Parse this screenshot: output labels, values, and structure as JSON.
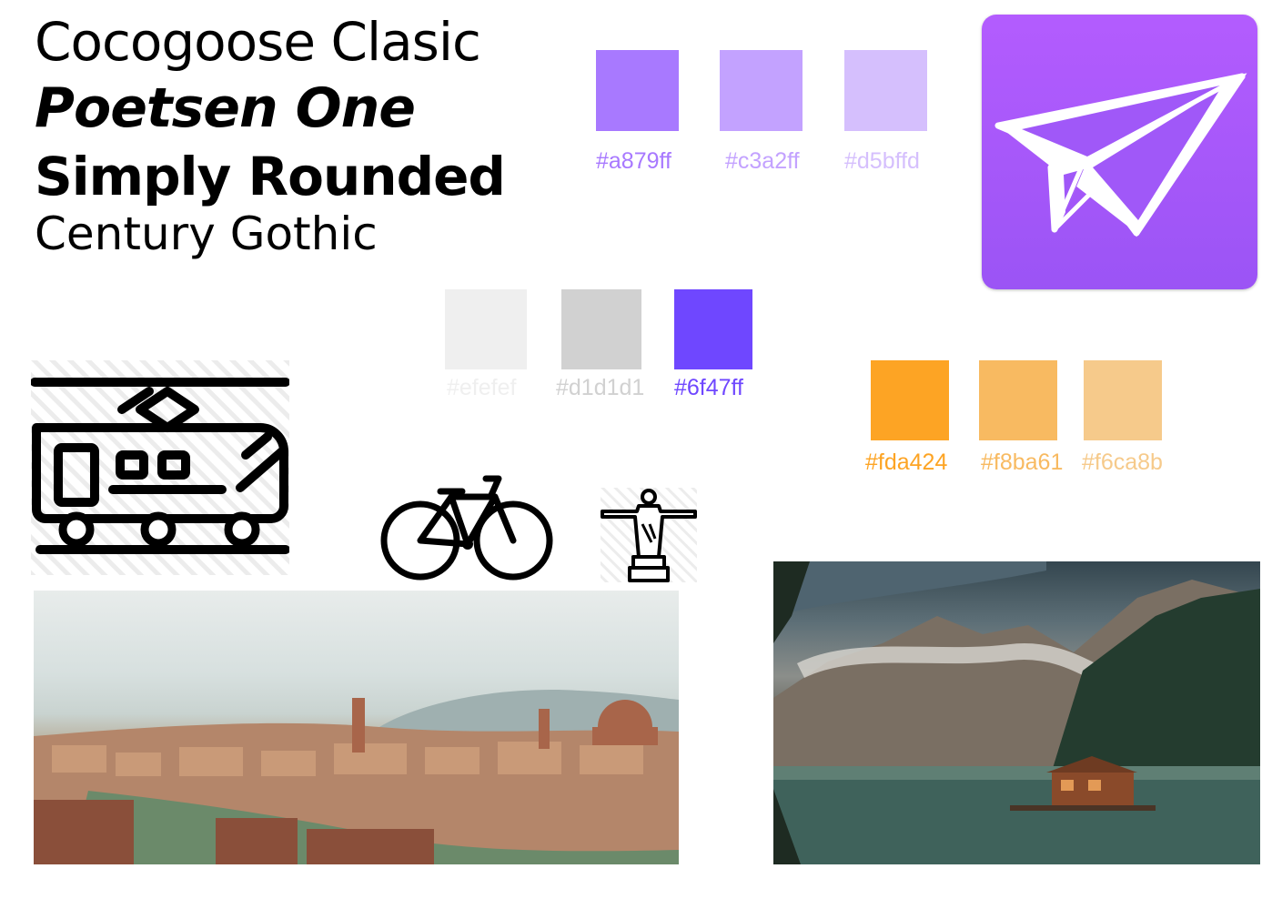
{
  "fonts": [
    "Cocogoose Clasic",
    "Poetsen One",
    "Simply Rounded",
    "Century Gothic"
  ],
  "palettes": {
    "purple": [
      {
        "hex": "#a879ff",
        "label": "#a879ff"
      },
      {
        "hex": "#c3a2ff",
        "label": "#c3a2ff"
      },
      {
        "hex": "#d5bffd",
        "label": "#d5bffd"
      }
    ],
    "neutral": [
      {
        "hex": "#efefef",
        "label": "#efefef"
      },
      {
        "hex": "#d1d1d1",
        "label": "#d1d1d1"
      },
      {
        "hex": "#6f47ff",
        "label": "#6f47ff"
      }
    ],
    "orange": [
      {
        "hex": "#fda424",
        "label": "#fda424"
      },
      {
        "hex": "#f8ba61",
        "label": "#f8ba61"
      },
      {
        "hex": "#f6ca8b",
        "label": "#f6ca8b"
      }
    ]
  },
  "icons": [
    "tram-icon",
    "bicycle-icon",
    "christ-redeemer-statue-icon",
    "paper-plane-icon"
  ],
  "photos": [
    "florence-cityscape-photo",
    "mountain-lake-cabin-photo"
  ]
}
